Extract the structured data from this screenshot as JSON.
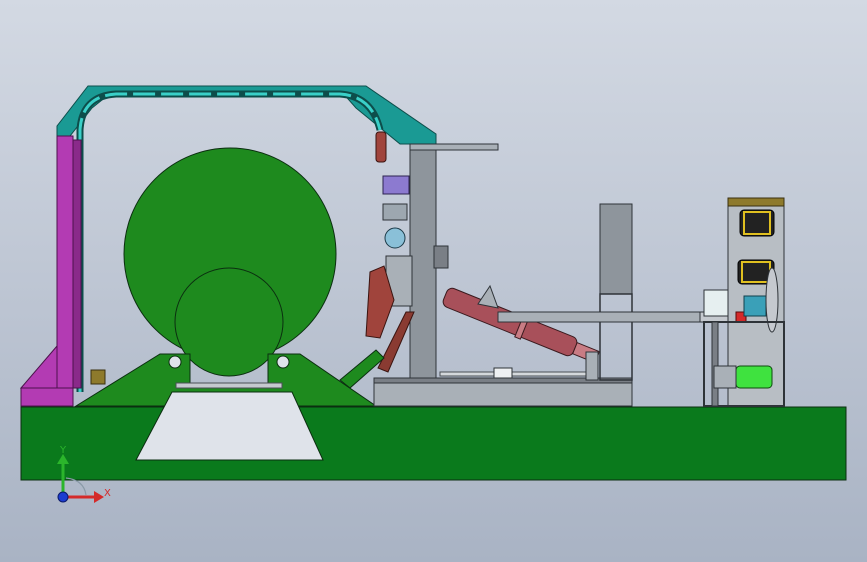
{
  "viewport": {
    "background_top": "#d3d9e3",
    "background_bottom": "#a9b3c4"
  },
  "triad": {
    "y_label": "Y",
    "x_label": "X",
    "y_color": "#2bb52b",
    "x_color": "#d42a2a",
    "z_color": "#1c3ccf"
  },
  "colors": {
    "base": "#0a7a1c",
    "drum": "#1e8a1e",
    "frame_teal": "#1a9a94",
    "frame_magenta": "#b33bb3",
    "steel": "#8e959c",
    "cylinder": "#a8505a",
    "rust": "#8a3b32",
    "motor": "#3fe23f"
  }
}
